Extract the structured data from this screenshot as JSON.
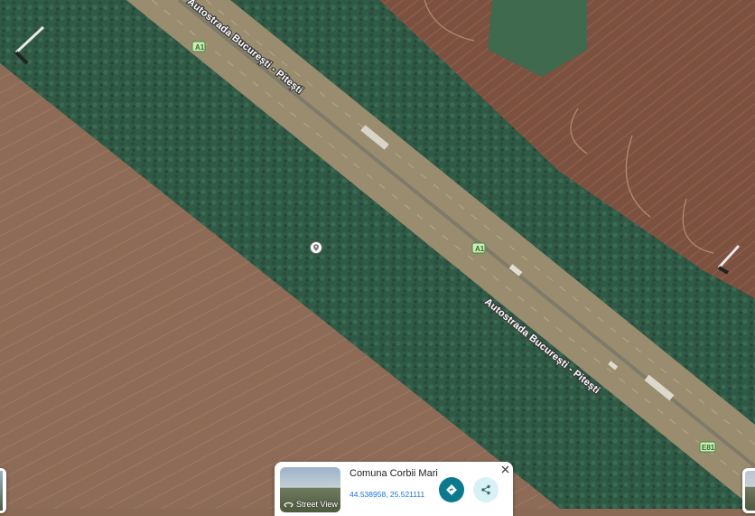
{
  "map": {
    "road_label_upper": "Autostrada București - Pitești",
    "road_label_lower": "Autostrada București - Pitești",
    "shield_a1_upper": "A1",
    "shield_a1_lower": "A1",
    "shield_e81": "E81",
    "watermark": "",
    "colors": {
      "field": "#8b6a55",
      "forest": "#2f5a44",
      "road": "#9e9070",
      "shield_bg": "#cfe9b8",
      "shield_text": "#2c6e2a"
    },
    "icons": {
      "place_marker": "location-pin-icon",
      "wind_turbine": "wind-turbine-icon"
    }
  },
  "info_card": {
    "title": "Comuna Corbii Mari",
    "coordinates": "44.538958, 25.521111",
    "street_view_label": "Street View",
    "icons": {
      "directions": "directions-icon",
      "share": "share-icon",
      "close": "close-icon",
      "street_view": "street-view-icon"
    },
    "colors": {
      "directions_button": "#0b7a8e",
      "share_button": "#d8f1f4",
      "coordinates_text": "#1a73e8"
    }
  }
}
